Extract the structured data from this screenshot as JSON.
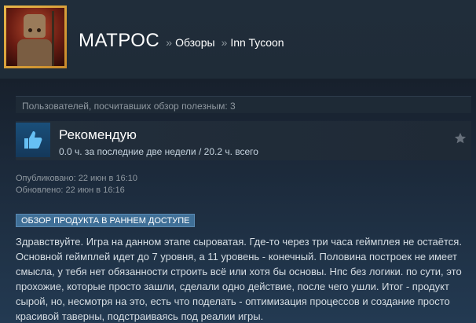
{
  "header": {
    "username": "МАТРОС",
    "separator": "»",
    "breadcrumb_reviews": "Обзоры",
    "breadcrumb_game": "Inn Tycoon"
  },
  "review": {
    "helpful_text": "Пользователей, посчитавших обзор полезным: 3",
    "recommendation": "Рекомендую",
    "hours": "0.0 ч. за последние две недели / 20.2 ч. всего",
    "published": "Опубликовано: 22 июн в 16:10",
    "updated": "Обновлено: 22 июн в 16:16",
    "early_access_badge": "ОБЗОР ПРОДУКТА В РАННЕМ ДОСТУПЕ",
    "text": "Здравствуйте. Игра на данном этапе сыроватая. Где-то через три часа геймплея не остаётся. Основной геймплей идет до 7 уровня, а 11 уровень - конечный. Половина построек не имеет смысла, у тебя нет обязанности строить всё или хотя бы основы. Нпс без логики. по сути, это прохожие, которые просто зашли, сделали одно действие, после чего ушли. Итог - продукт сырой, но, несмотря на это, есть что поделать - оптимизация процессов и создание просто красивой таверны, подстраиваясь под реалии игры."
  },
  "icons": {
    "thumb": "thumbs-up-icon",
    "star": "star-icon"
  },
  "colors": {
    "background": "#1b2838",
    "badge": "#3f6f97",
    "thumb_bg": "#1a4f7a",
    "thumb_icon": "#66c0f4"
  }
}
